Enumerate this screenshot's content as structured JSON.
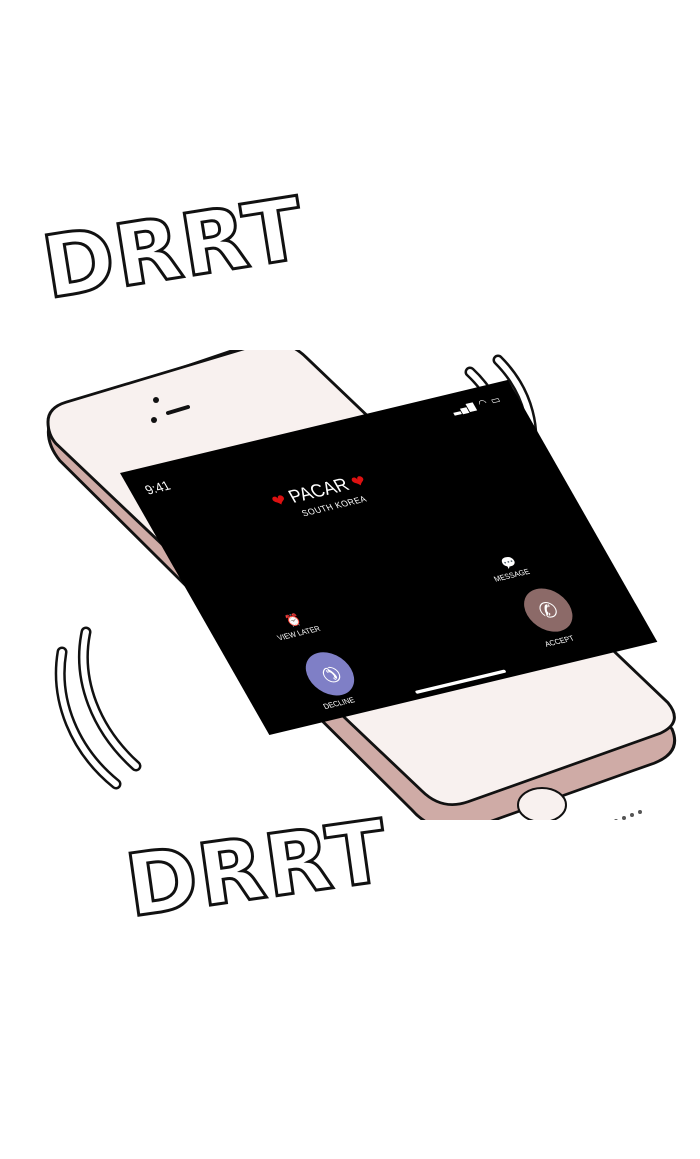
{
  "sound_effects": {
    "top": "DRRT",
    "bottom": "DRRT"
  },
  "colors": {
    "phone_body": "#f8f1ef",
    "phone_rim": "#cfaba6",
    "screen": "#000000",
    "accept": "#8c6a68",
    "decline": "#7f7fc6",
    "heart": "#d11111"
  },
  "phone": {
    "status": {
      "time": "9:41",
      "signal_icon": "signal-icon",
      "wifi_icon": "wifi-icon",
      "battery_icon": "battery-icon"
    },
    "call": {
      "caller_name": "PACAR",
      "caller_location": "SOUTH KOREA",
      "heart_icon": "heart-icon"
    },
    "options": {
      "message_label": "MESSAGE",
      "view_later_label": "VIEW LATER"
    },
    "buttons": {
      "accept_label": "ACCEPT",
      "decline_label": "DECLINE"
    }
  }
}
